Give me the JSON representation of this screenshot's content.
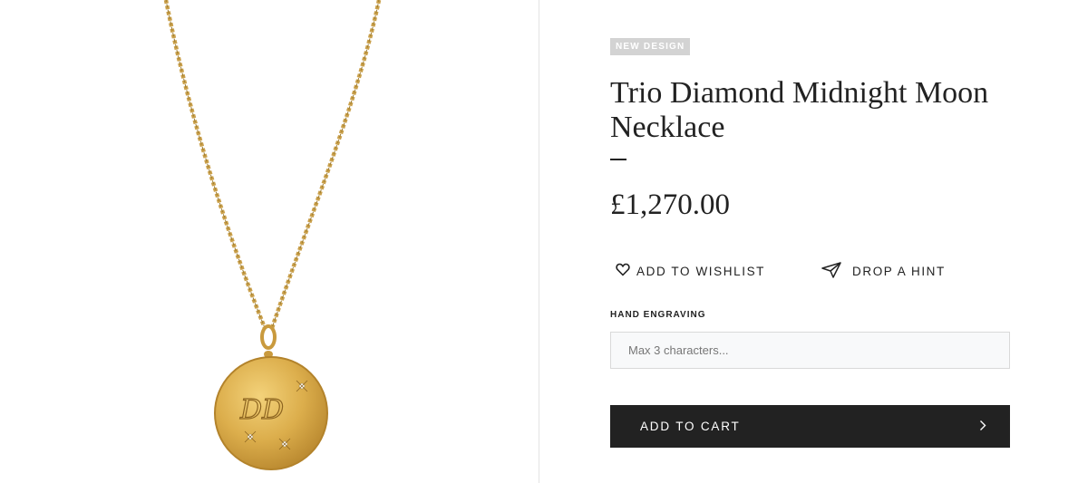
{
  "product": {
    "badge": "NEW DESIGN",
    "title": "Trio Diamond Midnight Moon Necklace",
    "price": "£1,270.00",
    "image_icon": "gold-necklace-pendant-image",
    "pendant_engraving": "DD"
  },
  "actions": {
    "wishlist_label": "ADD TO WISHLIST",
    "wishlist_icon": "heart-icon",
    "hint_label": "DROP A HINT",
    "hint_icon": "paper-plane-icon"
  },
  "engraving": {
    "label": "HAND ENGRAVING",
    "placeholder": "Max 3 characters...",
    "value": ""
  },
  "cart": {
    "label": "ADD TO CART",
    "icon": "chevron-right-icon"
  },
  "colors": {
    "accent_dark": "#222222",
    "badge_bg": "#d3d3d3",
    "gold": "#d9ac4a"
  }
}
